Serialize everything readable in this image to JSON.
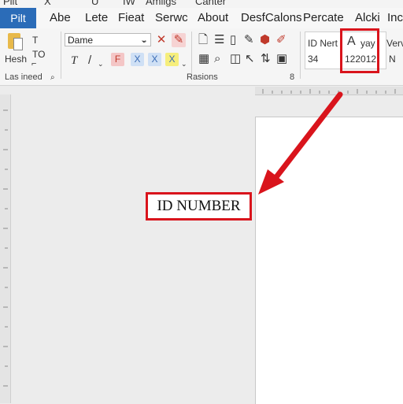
{
  "titlebar": {
    "items": [
      "Pilt",
      "X",
      "U",
      "IW",
      "Amligs",
      "Canter"
    ]
  },
  "tabs": {
    "file": "Pilt",
    "items": [
      "Abe",
      "Lete",
      "Fieat",
      "Serwc",
      "About",
      "DesfCalons",
      "Percate",
      "Alcki",
      "Inc"
    ]
  },
  "ribbon": {
    "clipboard": {
      "paste_label": "Hesh",
      "t_label": "T",
      "to_label": "TO",
      "group_label": "Las ineed"
    },
    "font": {
      "font_name": "Dame",
      "bold": "T",
      "italic": "/",
      "highlight_a": "F",
      "highlight_b": "X",
      "highlight_c": "X",
      "highlight_d": "X",
      "close_glyph": "✕",
      "pen_glyph": "✎"
    },
    "paragraph": {
      "group_label": "Rasions",
      "launcher": "8"
    },
    "styles": {
      "col1_top": "ID Nert",
      "col1_bottom": "34",
      "col2_top": "yay",
      "col2_bottom": "122012",
      "col2_icon": "A",
      "col3_top": "Vervi",
      "col3_bottom": "N"
    }
  },
  "document": {
    "id_label": "ID NUMBER"
  },
  "colors": {
    "accent_blue": "#2b6cb8",
    "annotation_red": "#d9141c"
  }
}
